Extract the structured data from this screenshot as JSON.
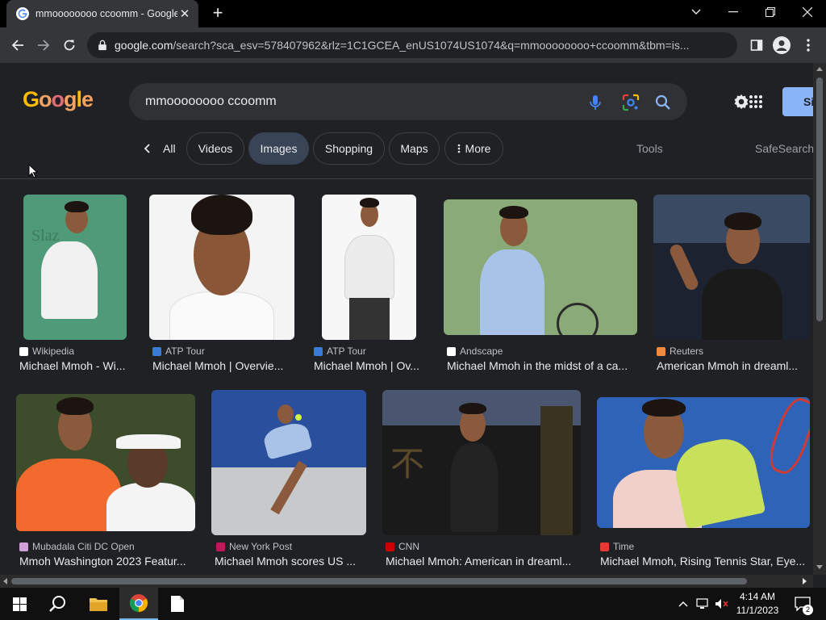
{
  "browser": {
    "tab_title": "mmoooooooo ccoomm - Google",
    "new_tab_label": "+",
    "url_host": "google.com",
    "url_rest": "/search?sca_esv=578407962&rlz=1C1GCEA_enUS1074US1074&q=mmoooooooo+ccoomm&tbm=is..."
  },
  "google": {
    "logo_text": "Google",
    "search_query": "mmoooooooo ccoomm",
    "signin_label": "Si",
    "chips": [
      {
        "label": "All"
      },
      {
        "label": "Videos"
      },
      {
        "label": "Images"
      },
      {
        "label": "Shopping"
      },
      {
        "label": "Maps"
      },
      {
        "label": "More"
      }
    ],
    "tools_label": "Tools",
    "safesearch_label": "SafeSearch"
  },
  "results": [
    {
      "source": "Wikipedia",
      "caption": "Michael Mmoh - Wi...",
      "fav_color": "#ffffff"
    },
    {
      "source": "ATP Tour",
      "caption": "Michael Mmoh | Overvie...",
      "fav_color": "#3a7bd5"
    },
    {
      "source": "ATP Tour",
      "caption": "Michael Mmoh | Ov...",
      "fav_color": "#3a7bd5"
    },
    {
      "source": "Andscape",
      "caption": "Michael Mmoh in the midst of a ca...",
      "fav_color": "#ffffff"
    },
    {
      "source": "Reuters",
      "caption": "American Mmoh in dreaml...",
      "fav_color": "#f08a3c"
    },
    {
      "source": "Mubadala Citi DC Open",
      "caption": "Mmoh Washington 2023 Featur...",
      "fav_color": "#d0a0d8"
    },
    {
      "source": "New York Post",
      "caption": "Michael Mmoh scores US ...",
      "fav_color": "#c2185b"
    },
    {
      "source": "CNN",
      "caption": "Michael Mmoh: American in dreaml...",
      "fav_color": "#cc0000"
    },
    {
      "source": "Time",
      "caption": "Michael Mmoh, Rising Tennis Star, Eye...",
      "fav_color": "#e53935"
    }
  ],
  "taskbar": {
    "time": "4:14 AM",
    "date": "11/1/2023",
    "notification_count": "2"
  }
}
